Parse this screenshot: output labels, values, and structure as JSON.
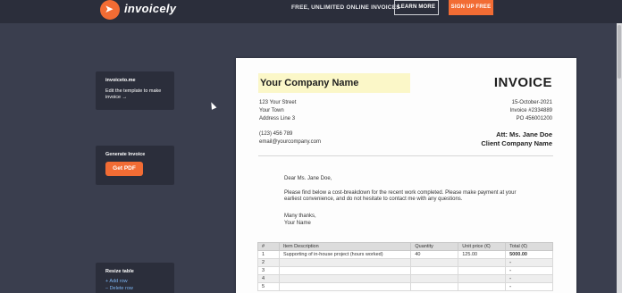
{
  "header": {
    "brand": "invoicely",
    "tagline": "FREE, UNLIMITED ONLINE INVOICES",
    "learn_more": "LEARN MORE",
    "signup": "SIGN UP FREE",
    "accent_color": "#f26c34"
  },
  "sidebar": {
    "template": {
      "title": "invoiceto.me",
      "text": "Edit the template to make invoice →"
    },
    "generate": {
      "title": "Generate Invoice",
      "button": "Get PDF"
    },
    "resize": {
      "title": "Resize table",
      "add_row": "+ Add row",
      "delete_row": "– Delete row"
    }
  },
  "invoice": {
    "company_name": "Your Company Name",
    "title": "INVOICE",
    "address": [
      "123 Your Street",
      "Your Town",
      "Address Line 3"
    ],
    "phone": "(123) 456 789",
    "email": "email@yourcompany.com",
    "date": "15-October-2021",
    "number": "Invoice #2334889",
    "po": "PO 456001200",
    "att": "Att: Ms. Jane Doe",
    "client_company": "Client Company Name",
    "letter": {
      "greeting": "Dear Ms. Jane Doe,",
      "body": "Please find below a cost-breakdown for the recent work completed. Please make payment at your earliest convenience, and do not hesitate to contact me with any questions.",
      "closing": "Many thanks,",
      "signature": "Your Name"
    },
    "table": {
      "headers": [
        "#",
        "Item Description",
        "Quantity",
        "Unit price (€)",
        "Total (€)"
      ],
      "rows": [
        [
          "1",
          "Supporting of in-house project (hours worked)",
          "40",
          "125.00",
          "5000.00"
        ],
        [
          "2",
          "",
          "",
          "",
          "-"
        ],
        [
          "3",
          "",
          "",
          "",
          "-"
        ],
        [
          "4",
          "",
          "",
          "",
          "-"
        ],
        [
          "5",
          "",
          "",
          "",
          "-"
        ]
      ]
    }
  }
}
